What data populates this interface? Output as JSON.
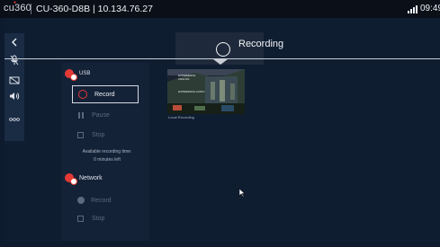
{
  "topbar": {
    "logo_text": "cu360",
    "logo_mark": "●",
    "device_title": "CU-360-D8B | 10.134.76.27",
    "clock": "09:49",
    "signal_icon": "signal-bars-icon"
  },
  "side_rail": {
    "items": [
      {
        "name": "back",
        "icon": "chevron-left-icon"
      },
      {
        "name": "mic",
        "icon": "mic-off-icon"
      },
      {
        "name": "camera",
        "icon": "camera-off-icon"
      },
      {
        "name": "volume",
        "icon": "volume-icon"
      },
      {
        "name": "more",
        "icon": "more-icon"
      }
    ]
  },
  "header": {
    "title": "Recording"
  },
  "usb": {
    "label": "USB",
    "record_label": "Record",
    "pause_label": "Pause",
    "stop_label": "Stop",
    "available_label": "Available recording time:",
    "available_value": "0 minutes left"
  },
  "network": {
    "label": "Network",
    "record_label": "Record",
    "stop_label": "Stop"
  },
  "thumbnail": {
    "caption": "Local Recording",
    "lines": [
      "EXPERIENCE",
      "ANALOG",
      "",
      "EXPERIENCE AUDIO"
    ]
  },
  "colors": {
    "background": "#0e1b2e",
    "accent_red": "#e53935",
    "disabled": "#5c6a80"
  }
}
